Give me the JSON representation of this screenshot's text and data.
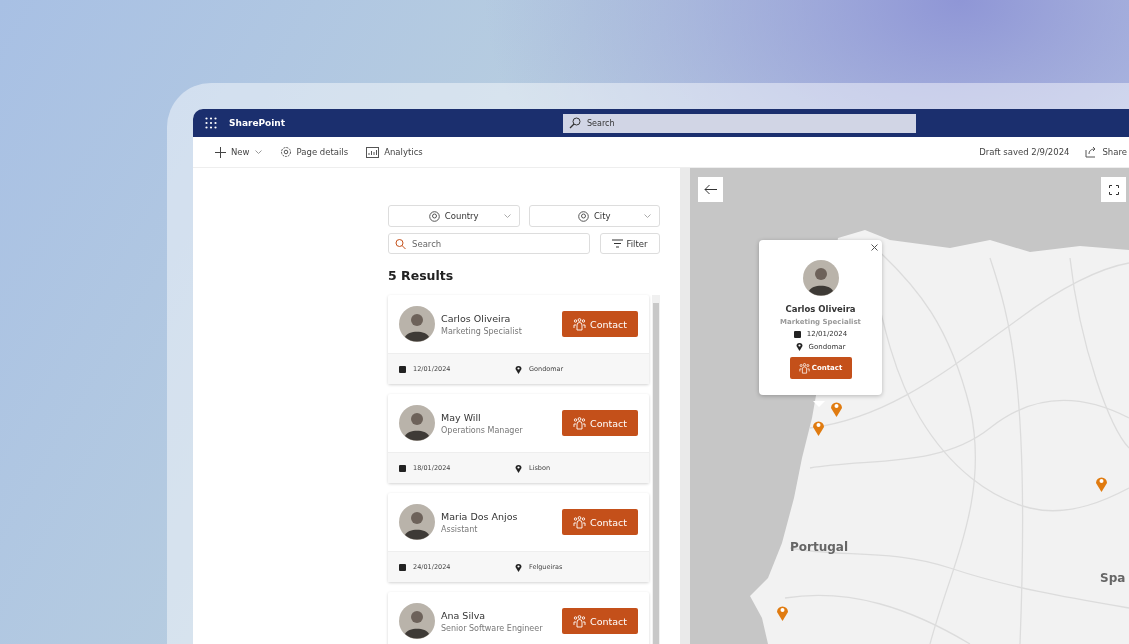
{
  "app": {
    "name": "SharePoint"
  },
  "search": {
    "placeholder": "Search"
  },
  "commands": [
    {
      "kind": "new",
      "label": "New"
    },
    {
      "kind": "details",
      "label": "Page details"
    },
    {
      "kind": "analytics",
      "label": "Analytics"
    }
  ],
  "draft_status": "Draft saved 2/9/2024",
  "share": {
    "label": "Share"
  },
  "filters": {
    "dropdowns": [
      {
        "label": "Country"
      },
      {
        "label": "City"
      }
    ],
    "search": {
      "placeholder": "Search"
    },
    "filter_button": "Filter"
  },
  "results_count": "5 Results",
  "results": [
    {
      "name": "Carlos Oliveira",
      "title": "Marketing Specialist",
      "date": "12/01/2024",
      "city": "Gondomar",
      "button": "Contact"
    },
    {
      "name": "May Will",
      "title": "Operations Manager",
      "date": "18/01/2024",
      "city": "Lisbon",
      "button": "Contact"
    },
    {
      "name": "Maria Dos Anjos",
      "title": "Assistant",
      "date": "24/01/2024",
      "city": "Felgueiras",
      "button": "Contact"
    },
    {
      "name": "Ana Silva",
      "title": "Senior Software Engineer",
      "button": "Contact"
    }
  ],
  "map": {
    "labels": [
      "Portugal",
      "Spa"
    ],
    "popup": {
      "name": "Carlos Oliveira",
      "title": "Marketing Specialist",
      "date": "12/01/2024",
      "city": "Gondomar",
      "button": "Contact"
    }
  }
}
